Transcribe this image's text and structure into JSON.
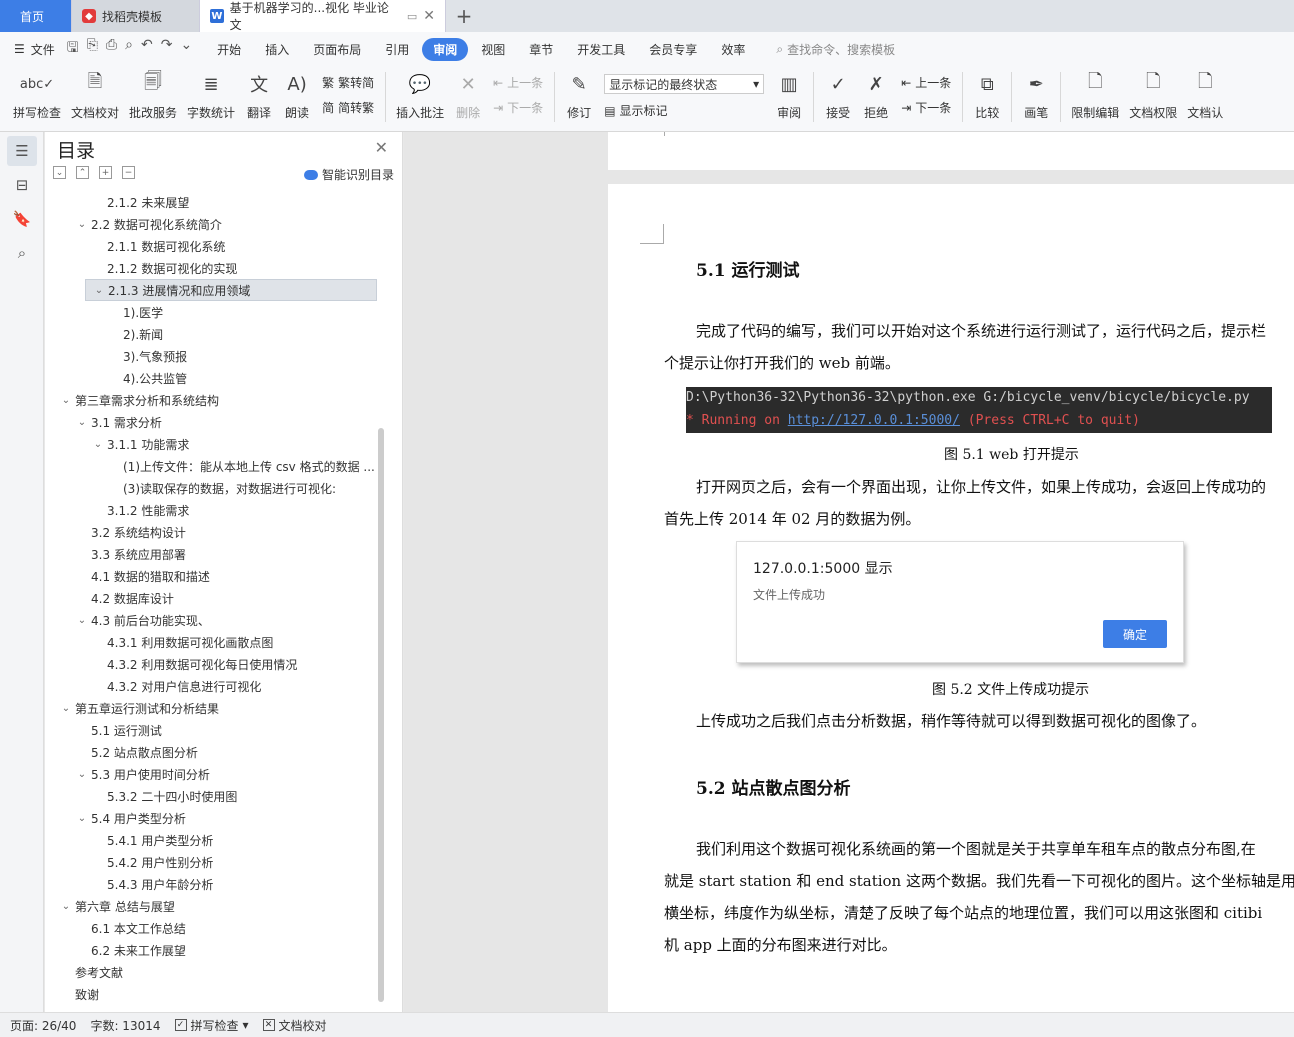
{
  "tabs": {
    "home": "首页",
    "template": "找稻壳模板",
    "doc": "基于机器学习的...视化 毕业论文",
    "add": "+"
  },
  "menu": {
    "file": "文件",
    "items": [
      "开始",
      "插入",
      "页面布局",
      "引用",
      "审阅",
      "视图",
      "章节",
      "开发工具",
      "会员专享",
      "效率"
    ],
    "active_index": 4,
    "search": "查找命令、搜索模板"
  },
  "ribbon": {
    "spell": "拼写检查",
    "proofread": "文档校对",
    "batch": "批改服务",
    "wordcount": "字数统计",
    "translate": "翻译",
    "read": "朗读",
    "trad": "繁转简",
    "simp": "简转繁",
    "insert_comment": "插入批注",
    "delete": "删除",
    "prev": "上一条",
    "next": "下一条",
    "revise": "修订",
    "markup_select": "显示标记的最终状态",
    "show_markup": "显示标记",
    "review": "审阅",
    "accept": "接受",
    "reject": "拒绝",
    "prev2": "上一条",
    "next2": "下一条",
    "compare": "比较",
    "pen": "画笔",
    "restrict": "限制编辑",
    "permission": "文档权限",
    "cert": "文档认"
  },
  "toc": {
    "title": "目录",
    "smart": "智能识别目录",
    "items": [
      {
        "text": "2.1.2  未来展望",
        "level": 3,
        "caret": ""
      },
      {
        "text": "2.2 数据可视化系统简介",
        "level": 2,
        "caret": "open"
      },
      {
        "text": "2.1.1 数据可视化系统",
        "level": 3,
        "caret": ""
      },
      {
        "text": "2.1.2  数据可视化的实现",
        "level": 3,
        "caret": ""
      },
      {
        "text": "2.1.3 进展情况和应用领域",
        "level": 3,
        "caret": "open",
        "selected": true
      },
      {
        "text": "1).医学",
        "level": 4,
        "caret": ""
      },
      {
        "text": "2).新闻",
        "level": 4,
        "caret": ""
      },
      {
        "text": "3).气象预报",
        "level": 4,
        "caret": ""
      },
      {
        "text": "4).公共监管",
        "level": 4,
        "caret": ""
      },
      {
        "text": "第三章需求分析和系统结构",
        "level": 1,
        "caret": "open"
      },
      {
        "text": "3.1 需求分析",
        "level": 2,
        "caret": "open"
      },
      {
        "text": "3.1.1 功能需求",
        "level": 3,
        "caret": "open"
      },
      {
        "text": "(1)上传文件：能从本地上传 csv 格式的数据 ...",
        "level": 4,
        "caret": ""
      },
      {
        "text": "(3)读取保存的数据，对数据进行可视化:",
        "level": 4,
        "caret": ""
      },
      {
        "text": "3.1.2 性能需求",
        "level": 3,
        "caret": ""
      },
      {
        "text": "3.2 系统结构设计",
        "level": 2,
        "caret": ""
      },
      {
        "text": "3.3 系统应用部署",
        "level": 2,
        "caret": ""
      },
      {
        "text": "4.1 数据的猎取和描述",
        "level": 2,
        "caret": ""
      },
      {
        "text": "4.2 数据库设计",
        "level": 2,
        "caret": ""
      },
      {
        "text": "4.3 前后台功能实现、",
        "level": 2,
        "caret": "open"
      },
      {
        "text": "4.3.1 利用数据可视化画散点图",
        "level": 3,
        "caret": ""
      },
      {
        "text": "4.3.2 利用数据可视化每日使用情况",
        "level": 3,
        "caret": ""
      },
      {
        "text": "4.3.2  对用户信息进行可视化",
        "level": 3,
        "caret": ""
      },
      {
        "text": "第五章运行测试和分析结果",
        "level": 1,
        "caret": "open"
      },
      {
        "text": "5.1  运行测试",
        "level": 2,
        "caret": ""
      },
      {
        "text": "5.2  站点散点图分析",
        "level": 2,
        "caret": ""
      },
      {
        "text": "5.3 用户使用时间分析",
        "level": 2,
        "caret": "open"
      },
      {
        "text": "5.3.2 二十四小时使用图",
        "level": 3,
        "caret": ""
      },
      {
        "text": "5.4  用户类型分析",
        "level": 2,
        "caret": "open"
      },
      {
        "text": "5.4.1 用户类型分析",
        "level": 3,
        "caret": ""
      },
      {
        "text": "5.4.2  用户性别分析",
        "level": 3,
        "caret": ""
      },
      {
        "text": "5.4.3 用户年龄分析",
        "level": 3,
        "caret": ""
      },
      {
        "text": "第六章  总结与展望",
        "level": 1,
        "caret": "open"
      },
      {
        "text": "6.1  本文工作总结",
        "level": 2,
        "caret": ""
      },
      {
        "text": "6.2 未来工作展望",
        "level": 2,
        "caret": ""
      },
      {
        "text": "参考文献",
        "level": 1,
        "caret": ""
      },
      {
        "text": "致谢",
        "level": 1,
        "caret": ""
      }
    ]
  },
  "doc": {
    "h_5_1": "5.1  运行测试",
    "p1a": "完成了代码的编写，我们可以开始对这个系统进行运行测试了，运行代码之后，提示栏",
    "p1b": "个提示让你打开我们的 web 前端。",
    "code_line1": "D:\\Python36-32\\Python36-32\\python.exe G:/bicycle_venv/bicycle/bicycle.py",
    "code_line2_pre": " * Running on ",
    "code_link": "http://127.0.0.1:5000/",
    "code_line2_post": " (Press CTRL+C to quit)",
    "fig1": "图 5.1    web 打开提示",
    "p2a": "打开网页之后，会有一个界面出现，让你上传文件，如果上传成功，会返回上传成功的",
    "p2b": "首先上传 2014 年 02 月的数据为例。",
    "dialog_title": "127.0.0.1:5000 显示",
    "dialog_msg": "文件上传成功",
    "dialog_ok": "确定",
    "fig2": "图 5.2  文件上传成功提示",
    "p3": "上传成功之后我们点击分析数据，稍作等待就可以得到数据可视化的图像了。",
    "h_5_2": "5.2  站点散点图分析",
    "p4a": "我们利用这个数据可视化系统画的第一个图就是关于共享单车租车点的散点分布图,在",
    "p4b": "就是 start station 和 end station 这两个数据。我们先看一下可视化的图片。这个坐标轴是用经",
    "p4c": "横坐标，纬度作为纵坐标，清楚了反映了每个站点的地理位置，我们可以用这张图和 citibi",
    "p4d": "机 app 上面的分布图来进行对比。"
  },
  "status": {
    "page": "页面: 26/40",
    "words": "字数: 13014",
    "spell": "拼写检查",
    "proof": "文档校对"
  },
  "colors": {
    "accent": "#3d7ee6",
    "code_bg": "#2b2b2b"
  }
}
